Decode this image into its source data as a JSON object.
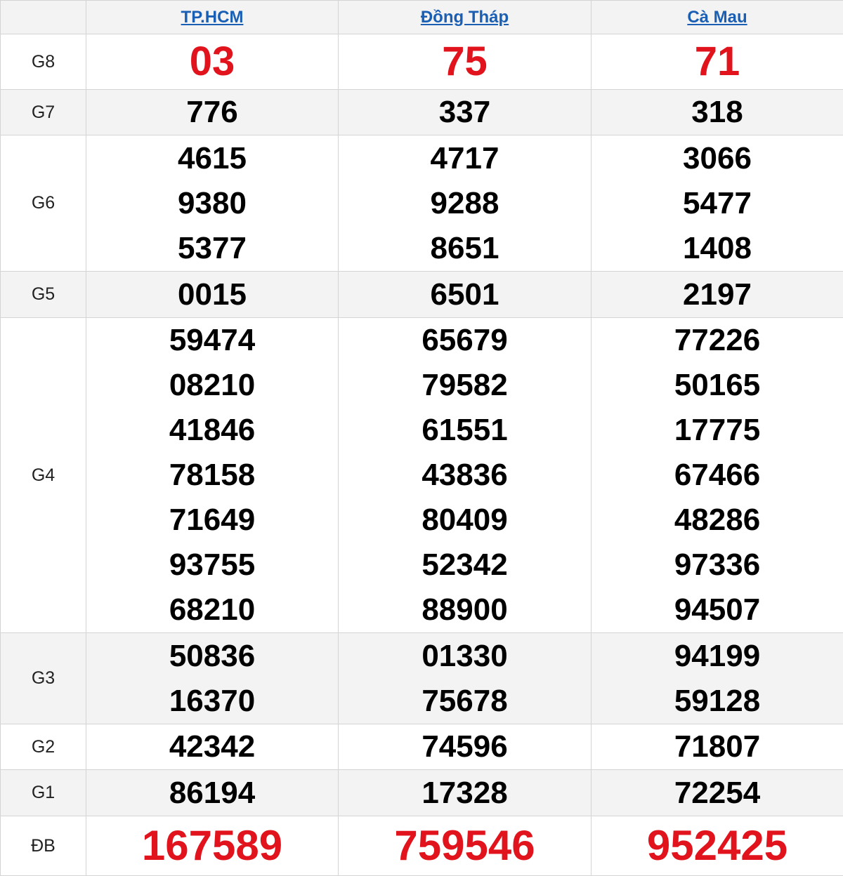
{
  "provinces": [
    "TP.HCM",
    "Đồng Tháp",
    "Cà Mau"
  ],
  "prizes": [
    {
      "label": "G8",
      "numbers": [
        [
          "03"
        ],
        [
          "75"
        ],
        [
          "71"
        ]
      ]
    },
    {
      "label": "G7",
      "numbers": [
        [
          "776"
        ],
        [
          "337"
        ],
        [
          "318"
        ]
      ]
    },
    {
      "label": "G6",
      "numbers": [
        [
          "4615",
          "9380",
          "5377"
        ],
        [
          "4717",
          "9288",
          "8651"
        ],
        [
          "3066",
          "5477",
          "1408"
        ]
      ]
    },
    {
      "label": "G5",
      "numbers": [
        [
          "0015"
        ],
        [
          "6501"
        ],
        [
          "2197"
        ]
      ]
    },
    {
      "label": "G4",
      "numbers": [
        [
          "59474",
          "08210",
          "41846",
          "78158",
          "71649",
          "93755",
          "68210"
        ],
        [
          "65679",
          "79582",
          "61551",
          "43836",
          "80409",
          "52342",
          "88900"
        ],
        [
          "77226",
          "50165",
          "17775",
          "67466",
          "48286",
          "97336",
          "94507"
        ]
      ]
    },
    {
      "label": "G3",
      "numbers": [
        [
          "50836",
          "16370"
        ],
        [
          "01330",
          "75678"
        ],
        [
          "94199",
          "59128"
        ]
      ]
    },
    {
      "label": "G2",
      "numbers": [
        [
          "42342"
        ],
        [
          "74596"
        ],
        [
          "71807"
        ]
      ]
    },
    {
      "label": "G1",
      "numbers": [
        [
          "86194"
        ],
        [
          "17328"
        ],
        [
          "72254"
        ]
      ]
    },
    {
      "label": "ĐB",
      "numbers": [
        [
          "167589"
        ],
        [
          "759546"
        ],
        [
          "952425"
        ]
      ]
    }
  ],
  "colors": {
    "highlight": "#e1131c",
    "link": "#1a5fb4",
    "stripe": "#f3f3f3",
    "border": "#d4d4d4"
  }
}
